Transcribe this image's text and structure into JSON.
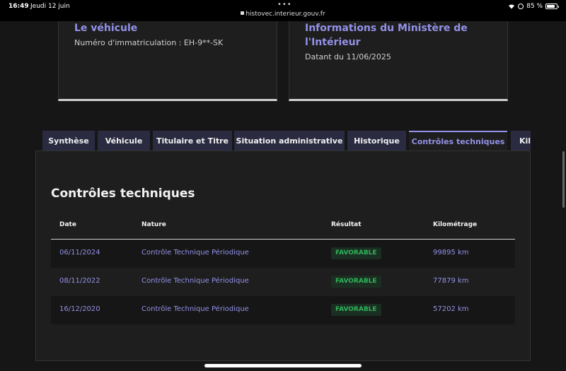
{
  "status": {
    "time": "16:49",
    "date": "Jeudi 12 juin",
    "url": "histovec.interieur.gouv.fr",
    "battery": "85 %"
  },
  "cards": {
    "vehicle": {
      "title": "Le véhicule",
      "text": "Numéro d'immatriculation : EH-9**-SK"
    },
    "ministry": {
      "title": "Informations du Ministère de l'Intérieur",
      "text": "Datant du 11/06/2025"
    }
  },
  "tabs": [
    {
      "label": "Synthèse"
    },
    {
      "label": "Véhicule"
    },
    {
      "label": "Titulaire et Titre"
    },
    {
      "label": "Situation administrative"
    },
    {
      "label": "Historique"
    },
    {
      "label": "Contrôles techniques"
    },
    {
      "label": "Kil"
    }
  ],
  "active_tab": "Contrôles techniques",
  "panel": {
    "title": "Contrôles techniques",
    "columns": [
      "Date",
      "Nature",
      "Résultat",
      "Kilométrage"
    ],
    "rows": [
      {
        "date": "06/11/2024",
        "nature": "Contrôle Technique Périodique",
        "result": "FAVORABLE",
        "km": "99895 km"
      },
      {
        "date": "08/11/2022",
        "nature": "Contrôle Technique Périodique",
        "result": "FAVORABLE",
        "km": "77879 km"
      },
      {
        "date": "16/12/2020",
        "nature": "Contrôle Technique Périodique",
        "result": "FAVORABLE",
        "km": "57202 km"
      }
    ]
  },
  "colors": {
    "accent": "#9391e8",
    "tab_bg": "#2a2a40",
    "success": "#2fb45a",
    "background": "#161616"
  }
}
